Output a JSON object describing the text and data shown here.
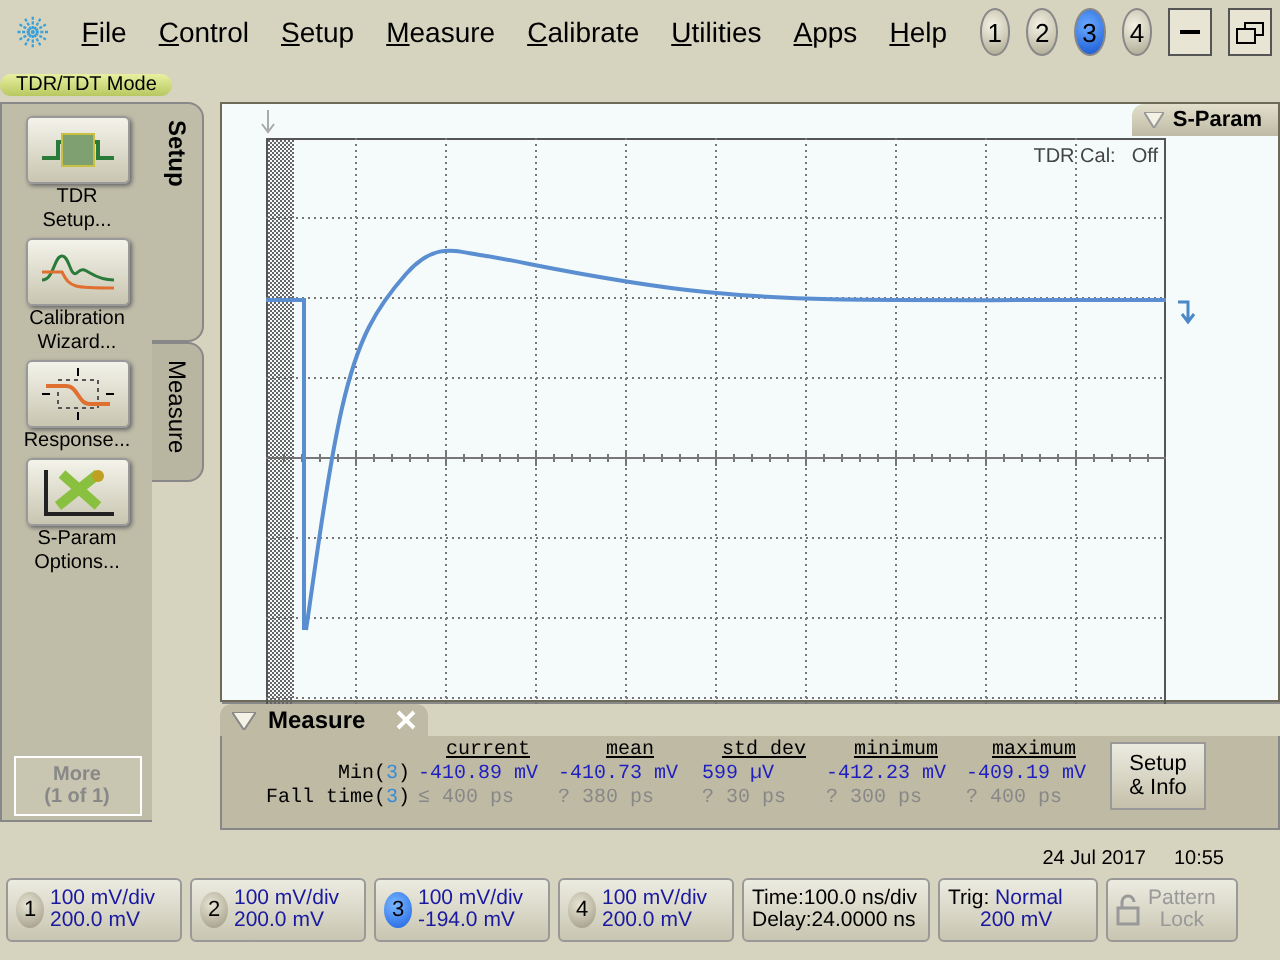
{
  "menu": {
    "items": [
      {
        "label": "File"
      },
      {
        "label": "Control"
      },
      {
        "label": "Setup"
      },
      {
        "label": "Measure"
      },
      {
        "label": "Calibrate"
      },
      {
        "label": "Utilities"
      },
      {
        "label": "Apps"
      },
      {
        "label": "Help"
      }
    ],
    "channel_buttons": [
      {
        "label": "1",
        "selected": false
      },
      {
        "label": "2",
        "selected": false
      },
      {
        "label": "3",
        "selected": true
      },
      {
        "label": "4",
        "selected": false
      }
    ]
  },
  "mode_label": "TDR/TDT Mode",
  "side_tabs": [
    {
      "label": "Setup",
      "selected": true
    },
    {
      "label": "Measure",
      "selected": false
    }
  ],
  "tool_buttons": [
    {
      "label": "TDR\nSetup...",
      "kind": "tdr"
    },
    {
      "label": "Calibration\nWizard...",
      "kind": "calibration"
    },
    {
      "label": "Response...",
      "kind": "response"
    },
    {
      "label": "S-Param\nOptions...",
      "kind": "sparam"
    }
  ],
  "more_button": {
    "label": "More\n(1 of 1)",
    "disabled": true
  },
  "graph": {
    "tab": "S-Param",
    "cal_label": "TDR Cal:",
    "cal_value": "Off"
  },
  "measure": {
    "title": "Measure",
    "columns": [
      "current",
      "mean",
      "std dev",
      "minimum",
      "maximum"
    ],
    "rows": [
      {
        "prefix": "Min(",
        "channel": "3",
        "suffix": ")",
        "valid": true,
        "values": [
          "-410.89 mV",
          "-410.73 mV",
          "599 µV",
          "-412.23 mV",
          "-409.19 mV"
        ]
      },
      {
        "prefix": "Fall time(",
        "channel": "3",
        "suffix": ")",
        "valid": false,
        "values": [
          "≤ 400 ps",
          "? 380 ps",
          "? 30 ps",
          "? 300 ps",
          "? 400 ps"
        ]
      }
    ],
    "button": "Setup\n& Info"
  },
  "date": "24 Jul 2017",
  "time": "10:55",
  "status_bar": {
    "channels": [
      {
        "number": "1",
        "scale": "100 mV/div",
        "offset": "200.0 mV",
        "selected": false
      },
      {
        "number": "2",
        "scale": "100 mV/div",
        "offset": "200.0 mV",
        "selected": false
      },
      {
        "number": "3",
        "scale": "100 mV/div",
        "offset": "-194.0 mV",
        "selected": true
      },
      {
        "number": "4",
        "scale": "100 mV/div",
        "offset": "200.0 mV",
        "selected": false
      }
    ],
    "time": "Time:100.0 ns/div",
    "delay": "Delay:24.0000 ns",
    "trig_label": "Trig:",
    "trig_mode": "Normal",
    "trig_level": "200 mV",
    "pattern_lock": {
      "label": "Pattern\nLock",
      "disabled": true
    }
  }
}
